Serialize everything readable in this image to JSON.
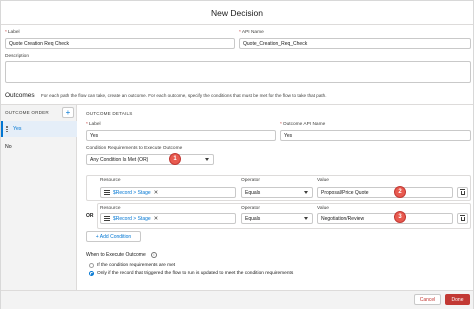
{
  "header": {
    "title": "New Decision"
  },
  "top_fields": {
    "label": {
      "label": "Label",
      "value": "Quote Creation Req Check"
    },
    "api_name": {
      "label": "API Name",
      "value": "Quote_Creation_Req_Check"
    },
    "description": {
      "label": "Description",
      "value": ""
    }
  },
  "outcomes": {
    "title": "Outcomes",
    "description": "For each path the flow can take, create an outcome. For each outcome, specify the conditions that must be met for the flow to take that path.",
    "order_label": "OUTCOME ORDER",
    "add_symbol": "+",
    "items": [
      "Yes",
      "No"
    ]
  },
  "details": {
    "title": "OUTCOME DETAILS",
    "label": {
      "label": "Label",
      "value": "Yes"
    },
    "api_name": {
      "label": "Outcome API Name",
      "value": "Yes"
    },
    "requirements": {
      "label": "Condition Requirements to Execute Outcome",
      "value": "Any Condition Is Met (OR)"
    },
    "condition_headers": {
      "resource": "Resource",
      "operator": "Operator",
      "value": "Value"
    },
    "conditions": [
      {
        "resource": "$Record > Stage",
        "operator": "Equals",
        "value": "Proposal/Price Quote"
      },
      {
        "resource": "$Record > Stage",
        "operator": "Equals",
        "value": "Negotiation/Review"
      }
    ],
    "or_label": "OR",
    "add_condition_label": "+ Add Condition",
    "remove_symbol": "✕",
    "execute": {
      "label": "When to Execute Outcome",
      "info_symbol": "i",
      "options": [
        {
          "text": "If the condition requirements are met",
          "checked": false
        },
        {
          "text": "Only if the record that triggered the flow to run is updated to meet the condition requirements",
          "checked": true
        }
      ]
    }
  },
  "badges": [
    "1",
    "2",
    "3"
  ],
  "required_marker": "*",
  "footer": {
    "cancel_label": "Cancel",
    "done_label": "Done"
  },
  "colors": {
    "brand": "#0176d3",
    "destructive": "#c23934",
    "badge": "#e85a4f"
  }
}
